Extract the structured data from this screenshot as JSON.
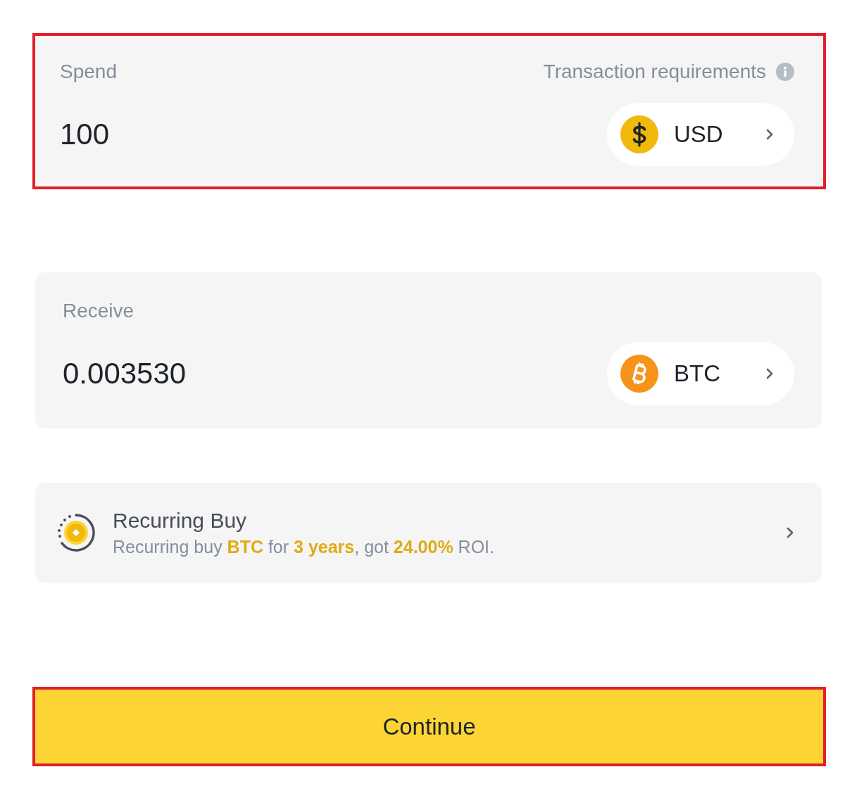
{
  "spend": {
    "label": "Spend",
    "highlighted": true,
    "requirements": "Transaction requirements",
    "amount": "100",
    "currency": {
      "code": "USD",
      "kind": "dollar"
    }
  },
  "receive": {
    "label": "Receive",
    "highlighted": false,
    "amount": "0.003530",
    "currency": {
      "code": "BTC",
      "kind": "bitcoin"
    }
  },
  "recurring_buy": {
    "title": "Recurring Buy",
    "description": "Recurring buy **BTC** for **3 years**, got **24.00%** ROI."
  },
  "continue_button": {
    "label": "Continue",
    "highlighted": true
  }
}
